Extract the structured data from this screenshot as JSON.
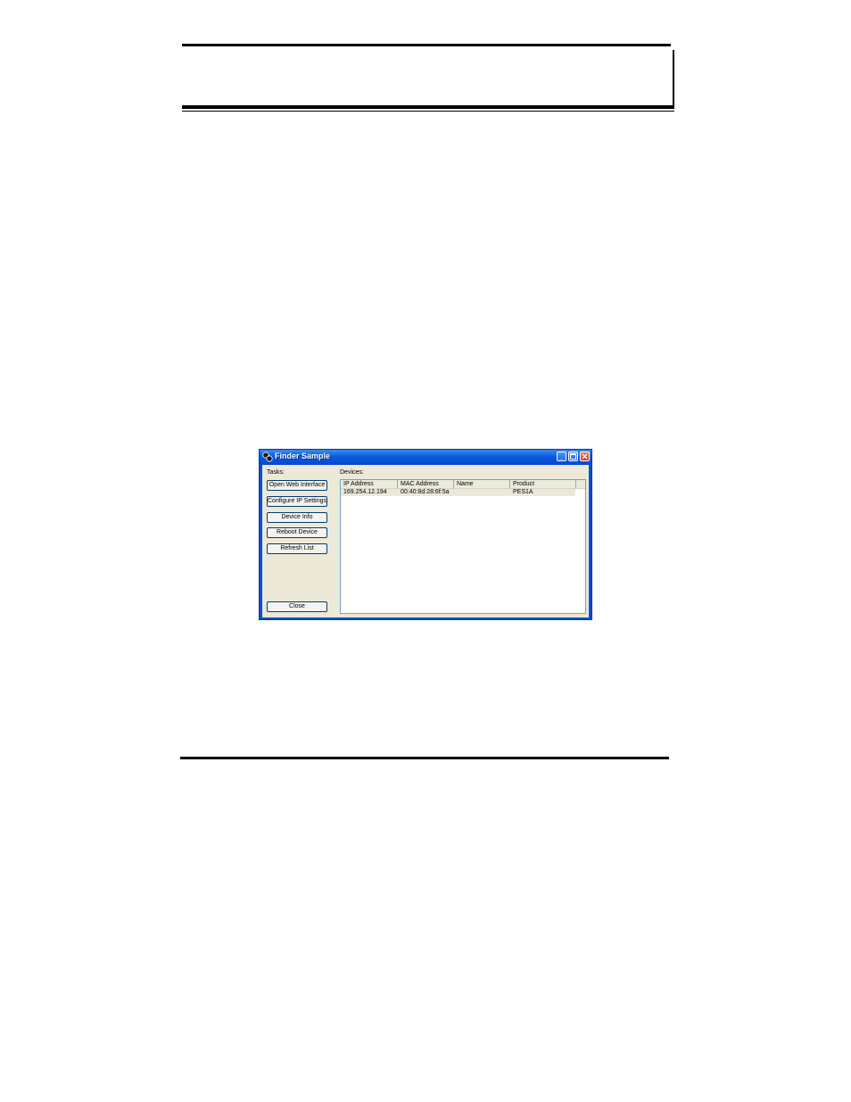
{
  "window": {
    "title": "Finder Sample",
    "icons": {
      "app": "finder-app-icon",
      "minimize": "minimize-icon",
      "maximize": "maximize-icon",
      "close": "close-icon"
    }
  },
  "tasks": {
    "label": "Tasks:",
    "buttons": [
      "Open Web Interface",
      "Configure IP Settings",
      "Device Info",
      "Reboot Device",
      "Refresh List"
    ],
    "close_label": "Close"
  },
  "devices": {
    "label": "Devices:",
    "columns": [
      "IP Address",
      "MAC Address",
      "Name",
      "Product"
    ],
    "rows": [
      [
        "169.254.12.194",
        "00:40:8d:28:6f:5a",
        "",
        "PES1A"
      ]
    ]
  },
  "colors": {
    "titlebar": "#0a5be0",
    "window_body": "#ece9d8",
    "selected_row": "#e9e8d9"
  }
}
